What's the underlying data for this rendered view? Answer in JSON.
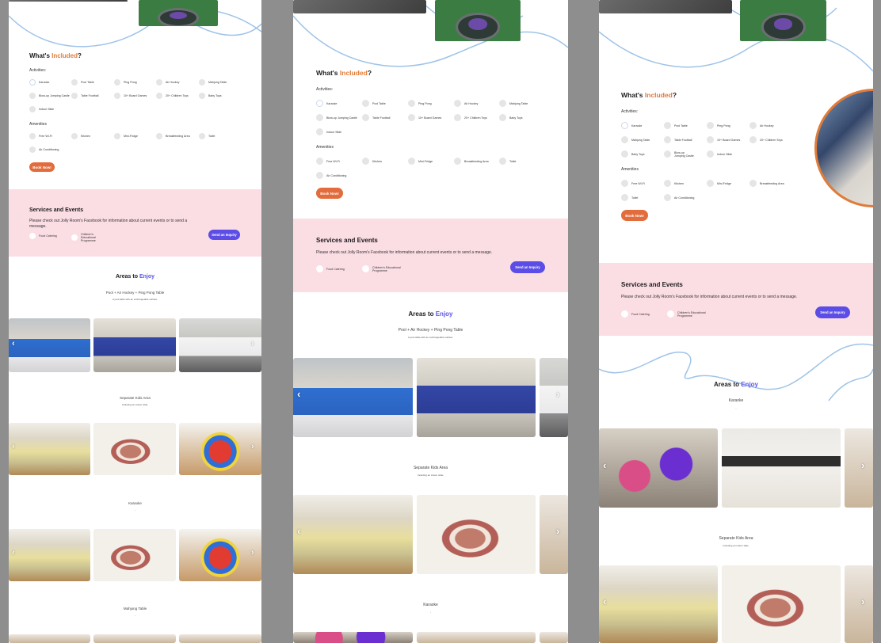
{
  "included": {
    "title_prefix": "What's ",
    "title_accent": "Included",
    "title_suffix": "?",
    "activities_label": "Activities:",
    "amenities_label": "Amenities",
    "activities_a": [
      "Karaoke",
      "Pool Table",
      "Ping Pong",
      "Air Hockey",
      "Mahjong Table",
      "Blow-up Jumping Castle",
      "Table Football",
      "10+ Board Games",
      "20+ Children Toys",
      "Baby Toys",
      "Indoor Slide"
    ],
    "activities_c": [
      "Karaoke",
      "Pool Table",
      "Ping Pong",
      "Air Hockey",
      "Mahjong Table",
      "Table Football",
      "10+ Board Games",
      "20+ Children Toys",
      "Baby Toys",
      "Blow-up Jumping Castle",
      "Indoor Slide"
    ],
    "amenities_a": [
      "Free Wi-Fi",
      "Kitchen",
      "Mini-Fridge",
      "Breastfeeding Area",
      "Toilet",
      "Air Conditioning"
    ],
    "amenities_c": [
      "Free Wi-Fi",
      "Kitchen",
      "Mini-Fridge",
      "Breastfeeding Area",
      "Toilet",
      "Air Conditioning"
    ],
    "book_label": "Book Now!"
  },
  "services": {
    "title": "Services and Events",
    "text": "Please check out Jolly Room's Facebook for information about current events or to send a message.",
    "options": [
      "Food Catering",
      "Children's Educational Programme"
    ],
    "inquiry_label": "Send an Inquiry"
  },
  "areas": {
    "title_prefix": "Areas to ",
    "title_accent": "Enjoy",
    "pool_title": "Pool + Air Hockey + Ping Pong Table",
    "pool_caption": "A pool table with an exchangeable surface.",
    "kids_title": "Separate Kids Area",
    "kids_caption": "Including an indoor slide.",
    "karaoke_title": "Karaoke",
    "karaoke_caption": "-",
    "mahjong_title": "Mahjong Table",
    "mahjong_caption": "-"
  },
  "colors": {
    "accent_orange": "#e07b39",
    "accent_blue": "#5a55e6",
    "pink_band": "#fbdde4",
    "button_orange": "#e36c3c",
    "button_purple": "#5b4de6"
  },
  "icons": {
    "prev": "chevron-left-icon",
    "next": "chevron-right-icon"
  }
}
